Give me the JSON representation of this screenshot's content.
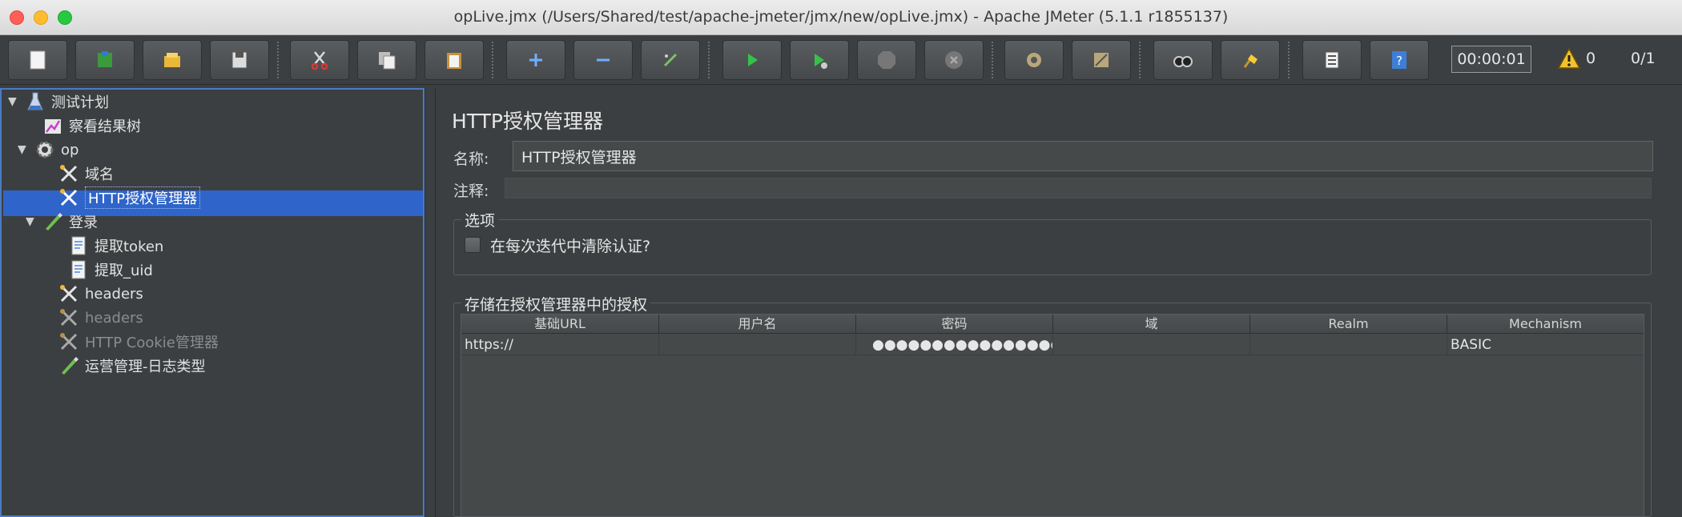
{
  "window": {
    "title": "opLive.jmx (/Users/Shared/test/apache-jmeter/jmx/new/opLive.jmx) - Apache JMeter (5.1.1 r1855137)"
  },
  "toolbar": {
    "buttons": [
      {
        "name": "new-icon"
      },
      {
        "name": "templates-icon"
      },
      {
        "name": "open-icon"
      },
      {
        "name": "save-icon"
      },
      {
        "name": "cut-icon"
      },
      {
        "name": "copy-icon"
      },
      {
        "name": "paste-icon"
      },
      {
        "name": "expand-icon"
      },
      {
        "name": "collapse-icon"
      },
      {
        "name": "toggle-icon"
      },
      {
        "name": "start-icon"
      },
      {
        "name": "start-no-pause-icon"
      },
      {
        "name": "stop-icon"
      },
      {
        "name": "shutdown-icon"
      },
      {
        "name": "remote-clear-icon"
      },
      {
        "name": "remote-clear-all-icon"
      },
      {
        "name": "search-icon"
      },
      {
        "name": "reset-search-icon"
      },
      {
        "name": "function-helper-icon"
      },
      {
        "name": "help-icon"
      }
    ],
    "timer": "00:00:01",
    "warning_count": "0",
    "thread_count": "0/1"
  },
  "tree": {
    "nodes": [
      {
        "label": "测试计划",
        "icon": "flask-icon",
        "arrow": "▼"
      },
      {
        "label": "察看结果树",
        "icon": "chart-icon",
        "arrow": ""
      },
      {
        "label": "op",
        "icon": "gear-icon",
        "arrow": "▼"
      },
      {
        "label": "域名",
        "icon": "tools-icon",
        "arrow": ""
      },
      {
        "label": "HTTP授权管理器",
        "icon": "tools-icon",
        "arrow": "",
        "selected": true
      },
      {
        "label": "登录",
        "icon": "pencil-icon",
        "arrow": "▼"
      },
      {
        "label": "提取token",
        "icon": "document-icon",
        "arrow": ""
      },
      {
        "label": "提取_uid",
        "icon": "document-icon",
        "arrow": ""
      },
      {
        "label": "headers",
        "icon": "tools-icon",
        "arrow": ""
      },
      {
        "label": "headers",
        "icon": "tools-icon",
        "arrow": "",
        "disabled": true
      },
      {
        "label": "HTTP Cookie管理器",
        "icon": "tools-icon",
        "arrow": "",
        "disabled": true
      },
      {
        "label": "运营管理-日志类型",
        "icon": "pencil-icon",
        "arrow": ""
      }
    ]
  },
  "panel": {
    "title": "HTTP授权管理器",
    "name_label": "名称:",
    "name_value": "HTTP授权管理器",
    "comment_label": "注释:",
    "options_title": "选项",
    "clear_each_iteration_label": "在每次迭代中清除认证?",
    "auth_group_title": "存储在授权管理器中的授权",
    "table": {
      "columns": [
        "基础URL",
        "用户名",
        "密码",
        "域",
        "Realm",
        "Mechanism"
      ],
      "rows": [
        [
          "https://",
          "",
          "●●●●●●●●●●●●●●●●",
          "",
          "",
          "BASIC"
        ]
      ]
    }
  }
}
